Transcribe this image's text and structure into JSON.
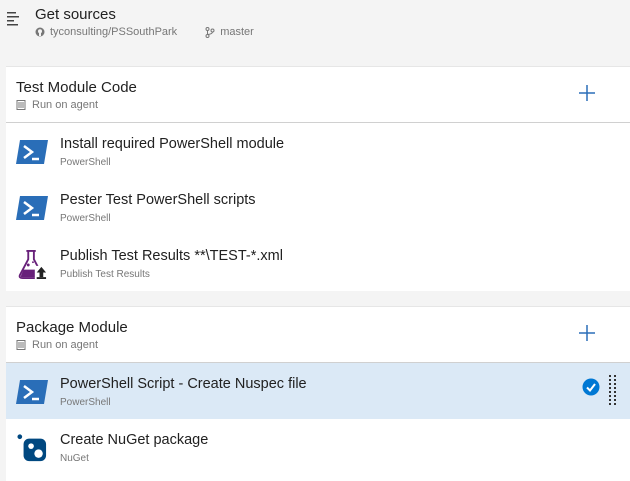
{
  "get_sources": {
    "title": "Get sources",
    "repo": "tyconsulting/PSSouthPark",
    "branch": "master"
  },
  "phases": [
    {
      "title": "Test Module Code",
      "subtitle": "Run on agent",
      "tasks": [
        {
          "name": "Install required PowerShell module",
          "type": "PowerShell",
          "icon": "powershell-icon"
        },
        {
          "name": "Pester Test PowerShell scripts",
          "type": "PowerShell",
          "icon": "powershell-icon"
        },
        {
          "name": "Publish Test Results **\\TEST-*.xml",
          "type": "Publish Test Results",
          "icon": "flask-upload-icon"
        }
      ]
    },
    {
      "title": "Package Module",
      "subtitle": "Run on agent",
      "tasks": [
        {
          "name": "PowerShell Script - Create Nuspec file",
          "type": "PowerShell",
          "icon": "powershell-icon",
          "selected": true
        },
        {
          "name": "Create NuGet package",
          "type": "NuGet",
          "icon": "nuget-icon"
        }
      ]
    }
  ],
  "colors": {
    "accent": "#0078d4",
    "selected_row": "#dbe9f6",
    "powershell": "#2a6eb8",
    "flask": "#68217a",
    "nuget": "#004880"
  }
}
